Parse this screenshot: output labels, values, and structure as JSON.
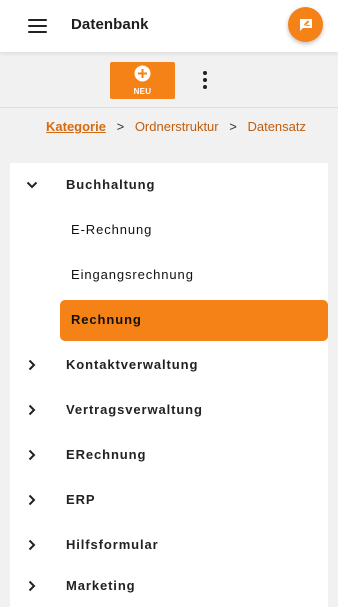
{
  "header": {
    "title": "Datenbank",
    "menu_icon": "hamburger-menu-icon",
    "fab_icon": "feedback-icon"
  },
  "toolbar": {
    "new_label": "NEU",
    "new_icon": "plus-circle-icon",
    "more_icon": "more-vert-icon"
  },
  "breadcrumb": {
    "items": [
      "Kategorie",
      "Ordnerstruktur",
      "Datensatz"
    ],
    "separator": ">"
  },
  "tree": {
    "items": [
      {
        "label": "Buchhaltung",
        "expanded": true
      },
      {
        "label": "E-Rechnung",
        "child": true
      },
      {
        "label": "Eingangsrechnung",
        "child": true
      },
      {
        "label": "Rechnung",
        "child": true,
        "selected": true
      },
      {
        "label": "Kontaktverwaltung",
        "expanded": false
      },
      {
        "label": "Vertragsverwaltung",
        "expanded": false
      },
      {
        "label": "ERechnung",
        "expanded": false
      },
      {
        "label": "ERP",
        "expanded": false
      },
      {
        "label": "Hilfsformular",
        "expanded": false
      },
      {
        "label": "Marketing",
        "expanded": false
      }
    ]
  },
  "colors": {
    "accent": "#f58216",
    "link": "#d56b10",
    "background": "#f1f1f1"
  }
}
